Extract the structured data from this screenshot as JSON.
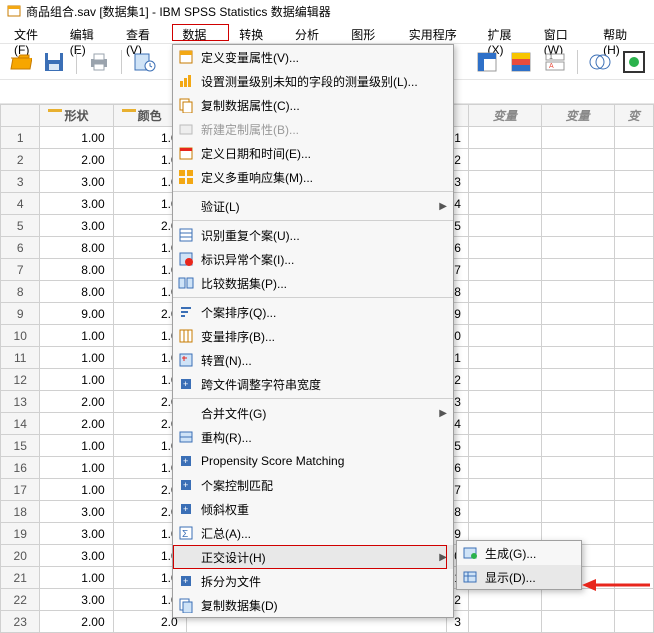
{
  "title": "商品组合.sav [数据集1] - IBM SPSS Statistics 数据编辑器",
  "menubar": [
    "文件(F)",
    "编辑(E)",
    "查看(V)",
    "数据(D)",
    "转换(T)",
    "分析(A)",
    "图形(G)",
    "实用程序(U)",
    "扩展(X)",
    "窗口(W)",
    "帮助(H)"
  ],
  "columns": {
    "c1": "形状",
    "c2": "颜色",
    "varlabel": "变量"
  },
  "grid": {
    "rows": [
      {
        "n": "1",
        "c1": "1.00",
        "c2": "1.0",
        "r": "1"
      },
      {
        "n": "2",
        "c1": "2.00",
        "c2": "1.0",
        "r": "2"
      },
      {
        "n": "3",
        "c1": "3.00",
        "c2": "1.0",
        "r": "3"
      },
      {
        "n": "4",
        "c1": "3.00",
        "c2": "1.0",
        "r": "4"
      },
      {
        "n": "5",
        "c1": "3.00",
        "c2": "2.0",
        "r": "5"
      },
      {
        "n": "6",
        "c1": "8.00",
        "c2": "1.0",
        "r": "6"
      },
      {
        "n": "7",
        "c1": "8.00",
        "c2": "1.0",
        "r": "7"
      },
      {
        "n": "8",
        "c1": "8.00",
        "c2": "1.0",
        "r": "8"
      },
      {
        "n": "9",
        "c1": "9.00",
        "c2": "2.0",
        "r": "9"
      },
      {
        "n": "10",
        "c1": "1.00",
        "c2": "1.0",
        "r": "0"
      },
      {
        "n": "11",
        "c1": "1.00",
        "c2": "1.0",
        "r": "1"
      },
      {
        "n": "12",
        "c1": "1.00",
        "c2": "1.0",
        "r": "2"
      },
      {
        "n": "13",
        "c1": "2.00",
        "c2": "2.0",
        "r": "3"
      },
      {
        "n": "14",
        "c1": "2.00",
        "c2": "2.0",
        "r": "4"
      },
      {
        "n": "15",
        "c1": "1.00",
        "c2": "1.0",
        "r": "5"
      },
      {
        "n": "16",
        "c1": "1.00",
        "c2": "1.0",
        "r": "6"
      },
      {
        "n": "17",
        "c1": "1.00",
        "c2": "2.0",
        "r": "7"
      },
      {
        "n": "18",
        "c1": "3.00",
        "c2": "2.0",
        "r": "8"
      },
      {
        "n": "19",
        "c1": "3.00",
        "c2": "1.0",
        "r": "9"
      },
      {
        "n": "20",
        "c1": "3.00",
        "c2": "1.0",
        "r": "0"
      },
      {
        "n": "21",
        "c1": "1.00",
        "c2": "1.0",
        "r": "1"
      },
      {
        "n": "22",
        "c1": "3.00",
        "c2": "1.0",
        "r": "2"
      },
      {
        "n": "23",
        "c1": "2.00",
        "c2": "2.0",
        "r": "3"
      }
    ]
  },
  "data_menu": [
    {
      "icon": "vars",
      "label": "定义变量属性(V)...",
      "type": "item"
    },
    {
      "icon": "level",
      "label": "设置测量级别未知的字段的测量级别(L)...",
      "type": "item"
    },
    {
      "icon": "copy",
      "label": "复制数据属性(C)...",
      "type": "item"
    },
    {
      "icon": "newattr",
      "label": "新建定制属性(B)...",
      "type": "disabled"
    },
    {
      "icon": "date",
      "label": "定义日期和时间(E)...",
      "type": "item"
    },
    {
      "icon": "mresp",
      "label": "定义多重响应集(M)...",
      "type": "item"
    },
    {
      "type": "divider"
    },
    {
      "icon": "",
      "label": "验证(L)",
      "type": "sub"
    },
    {
      "type": "divider"
    },
    {
      "icon": "dup",
      "label": "识别重复个案(U)...",
      "type": "item"
    },
    {
      "icon": "unusual",
      "label": "标识异常个案(I)...",
      "type": "item"
    },
    {
      "icon": "compare",
      "label": "比较数据集(P)...",
      "type": "item"
    },
    {
      "type": "divider"
    },
    {
      "icon": "sortc",
      "label": "个案排序(Q)...",
      "type": "item"
    },
    {
      "icon": "sortv",
      "label": "变量排序(B)...",
      "type": "item"
    },
    {
      "icon": "trans",
      "label": "转置(N)...",
      "type": "item"
    },
    {
      "icon": "adjust",
      "label": "跨文件调整字符串宽度",
      "type": "item"
    },
    {
      "type": "divider"
    },
    {
      "icon": "",
      "label": "合并文件(G)",
      "type": "sub"
    },
    {
      "icon": "restruct",
      "label": "重构(R)...",
      "type": "item"
    },
    {
      "icon": "psm",
      "label": "Propensity Score Matching",
      "type": "item"
    },
    {
      "icon": "casectl",
      "label": "个案控制匹配",
      "type": "item"
    },
    {
      "icon": "rake",
      "label": "倾斜权重",
      "type": "item"
    },
    {
      "icon": "agg",
      "label": "汇总(A)...",
      "type": "item"
    },
    {
      "icon": "",
      "label": "正交设计(H)",
      "type": "sub",
      "boxed": true,
      "hover": true
    },
    {
      "icon": "split",
      "label": "拆分为文件",
      "type": "item"
    },
    {
      "icon": "copyds",
      "label": "复制数据集(D)",
      "type": "item"
    }
  ],
  "orth_submenu": [
    {
      "icon": "gen",
      "label": "生成(G)..."
    },
    {
      "icon": "disp",
      "label": "显示(D)...",
      "hover": true
    }
  ]
}
